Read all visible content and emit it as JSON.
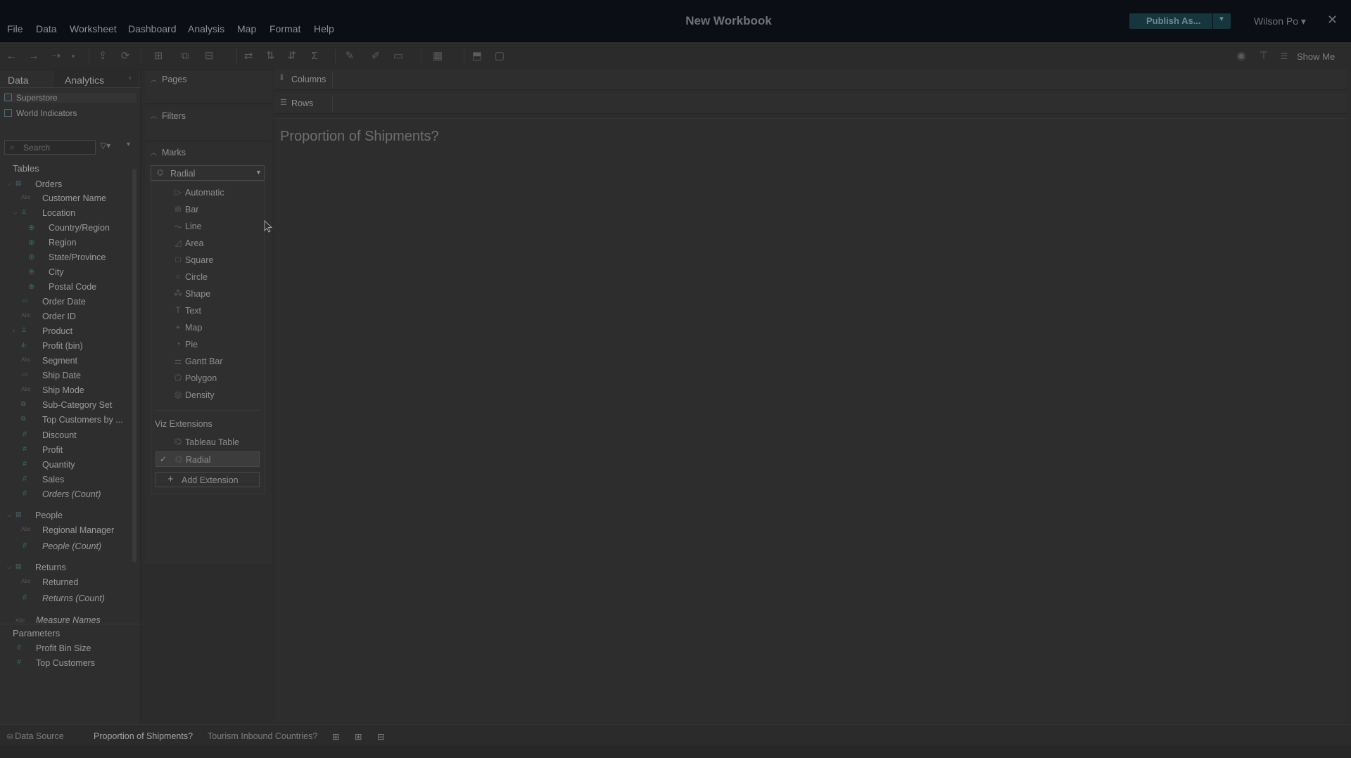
{
  "menu": [
    "File",
    "Data",
    "Worksheet",
    "Dashboard",
    "Analysis",
    "Map",
    "Format",
    "Help"
  ],
  "workbook_title": "New Workbook",
  "publish_label": "Publish As...",
  "user_label": "Wilson Po ▾",
  "show_me_label": "Show Me",
  "data_pane": {
    "tab_data": "Data",
    "tab_analytics": "Analytics",
    "data_sources": [
      "Superstore",
      "World Indicators"
    ],
    "search_placeholder": "Search",
    "tables_heading": "Tables",
    "orders": {
      "name": "Orders",
      "fields": {
        "customer_name": "Customer Name",
        "location": "Location",
        "country_region": "Country/Region",
        "region": "Region",
        "state_province": "State/Province",
        "city": "City",
        "postal_code": "Postal Code",
        "order_date": "Order Date",
        "order_id": "Order ID",
        "product": "Product",
        "profit_bin": "Profit (bin)",
        "segment": "Segment",
        "ship_date": "Ship Date",
        "ship_mode": "Ship Mode",
        "sub_category_set": "Sub-Category Set",
        "top_customers_by": "Top Customers by ...",
        "discount": "Discount",
        "profit": "Profit",
        "quantity": "Quantity",
        "sales": "Sales",
        "orders_count": "Orders (Count)"
      }
    },
    "people": {
      "name": "People",
      "regional_manager": "Regional Manager",
      "people_count": "People (Count)"
    },
    "returns": {
      "name": "Returns",
      "returned": "Returned",
      "returns_count": "Returns (Count)"
    },
    "measure_names": "Measure Names",
    "parameters_heading": "Parameters",
    "parameters": [
      "Profit Bin Size",
      "Top Customers"
    ]
  },
  "shelves": {
    "pages": "Pages",
    "filters": "Filters",
    "marks": "Marks",
    "columns": "Columns",
    "rows": "Rows"
  },
  "marks_dropdown": {
    "selected": "Radial",
    "items": [
      "Automatic",
      "Bar",
      "Line",
      "Area",
      "Square",
      "Circle",
      "Shape",
      "Text",
      "Map",
      "Pie",
      "Gantt Bar",
      "Polygon",
      "Density"
    ],
    "viz_extensions_heading": "Viz Extensions",
    "extensions": [
      "Tableau Table",
      "Radial"
    ],
    "add_extension": "Add Extension"
  },
  "sheet_title": "Proportion of Shipments?",
  "sheet_tabs": {
    "data_source": "Data Source",
    "sheets": [
      "Proportion of Shipments?",
      "Tourism Inbound Countries?"
    ]
  }
}
